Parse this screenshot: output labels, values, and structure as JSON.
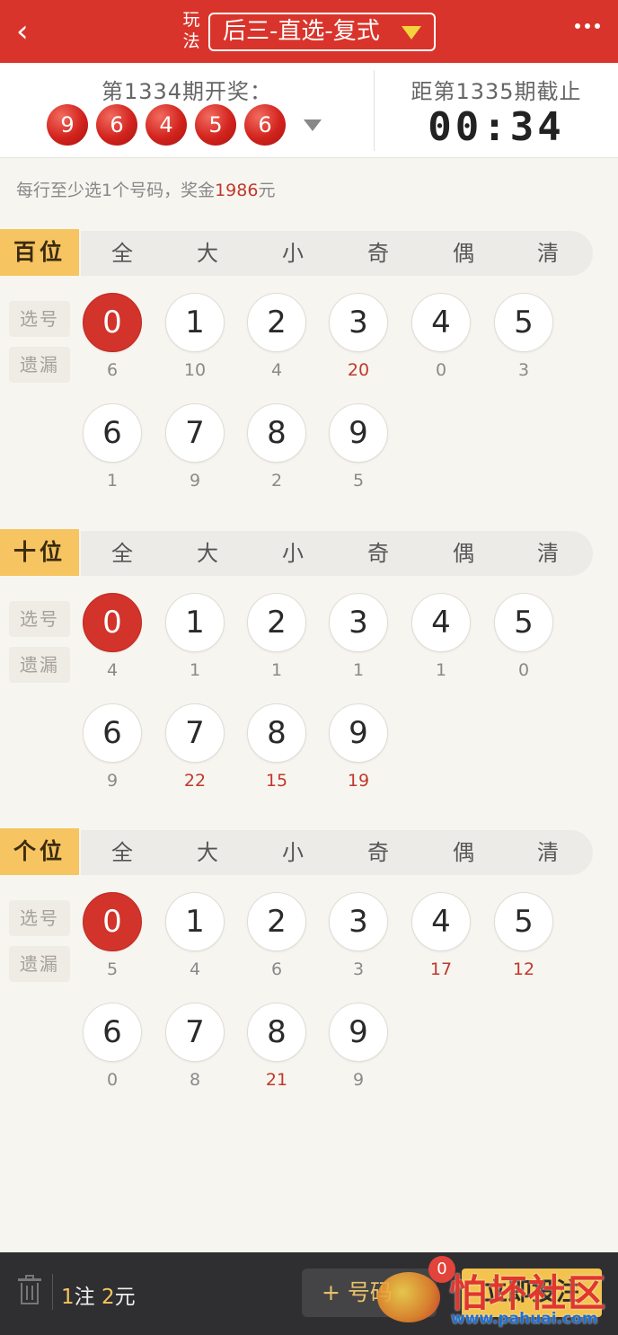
{
  "header": {
    "back_label": "‹",
    "wanfa_top": "玩",
    "wanfa_bottom": "法",
    "play_type": "后三-直选-复式",
    "more_icon": "more-icon"
  },
  "last_draw": {
    "title": "第1334期开奖：",
    "numbers": [
      "9",
      "6",
      "4",
      "5",
      "6"
    ]
  },
  "next_draw": {
    "title": "距第1335期截止",
    "countdown": "00:34"
  },
  "hint": {
    "prefix": "每行至少选1个号码，奖金",
    "prize": "1986",
    "suffix": "元"
  },
  "sections": [
    {
      "label": "百位",
      "quick": [
        "全",
        "大",
        "小",
        "奇",
        "偶",
        "清"
      ],
      "tag_select": "选号",
      "tag_missing": "遗漏",
      "numbers": [
        "0",
        "1",
        "2",
        "3",
        "4",
        "5",
        "6",
        "7",
        "8",
        "9"
      ],
      "selected": [
        "0"
      ],
      "missing": [
        "6",
        "10",
        "4",
        "20",
        "0",
        "3",
        "1",
        "9",
        "2",
        "5"
      ],
      "hot": [
        "3"
      ]
    },
    {
      "label": "十位",
      "quick": [
        "全",
        "大",
        "小",
        "奇",
        "偶",
        "清"
      ],
      "tag_select": "选号",
      "tag_missing": "遗漏",
      "numbers": [
        "0",
        "1",
        "2",
        "3",
        "4",
        "5",
        "6",
        "7",
        "8",
        "9"
      ],
      "selected": [
        "0"
      ],
      "missing": [
        "4",
        "1",
        "1",
        "1",
        "1",
        "0",
        "9",
        "22",
        "15",
        "19"
      ],
      "hot": [
        "7",
        "8",
        "9"
      ]
    },
    {
      "label": "个位",
      "quick": [
        "全",
        "大",
        "小",
        "奇",
        "偶",
        "清"
      ],
      "tag_select": "选号",
      "tag_missing": "遗漏",
      "numbers": [
        "0",
        "1",
        "2",
        "3",
        "4",
        "5",
        "6",
        "7",
        "8",
        "9"
      ],
      "selected": [
        "0"
      ],
      "missing": [
        "5",
        "4",
        "6",
        "3",
        "17",
        "12",
        "0",
        "8",
        "21",
        "9"
      ],
      "hot": [
        "4",
        "5",
        "8"
      ]
    }
  ],
  "footer": {
    "bet_count": "1",
    "bet_unit": "注",
    "amount": "2",
    "amount_unit": "元",
    "basket_label": "+ 号码",
    "basket_badge": "0",
    "confirm_label": "立即投注"
  },
  "watermark": {
    "text": "怕坏社区",
    "url": "www.pahuai.com"
  },
  "colors": {
    "header_red": "#d9342b",
    "selected_red": "#d2332b",
    "hot_text": "#c0392b",
    "position_label": "#f6c460",
    "confirm_button": "#f2c34f"
  }
}
